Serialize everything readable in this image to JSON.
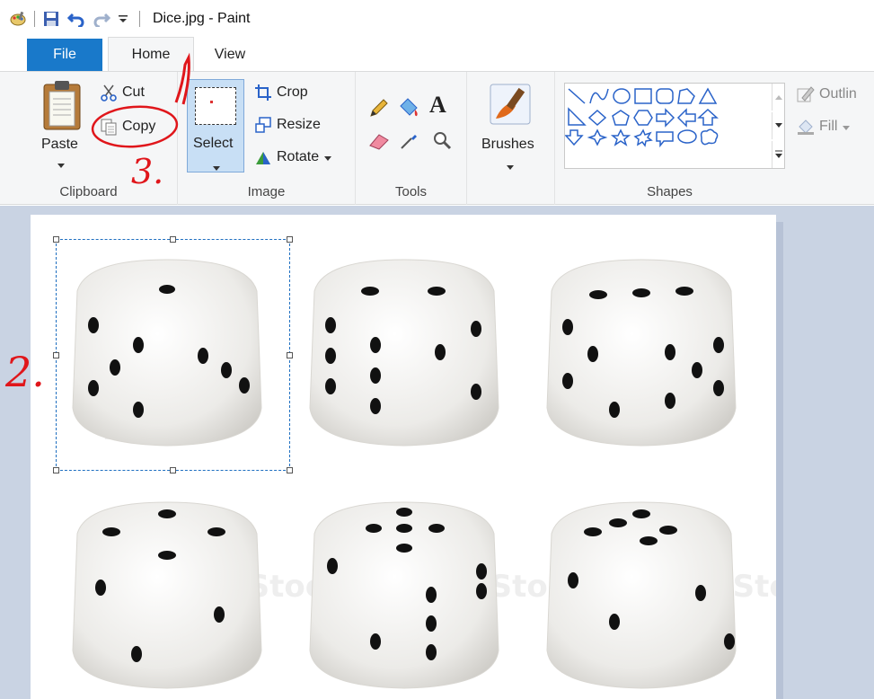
{
  "window": {
    "title": "Dice.jpg - Paint"
  },
  "quick_access": {
    "items": [
      "paint-app-icon",
      "save-icon",
      "undo-icon",
      "redo-icon",
      "customize-icon"
    ]
  },
  "tabs": [
    {
      "label": "File",
      "active": false
    },
    {
      "label": "Home",
      "active": true
    },
    {
      "label": "View",
      "active": false
    }
  ],
  "ribbon": {
    "clipboard": {
      "label": "Clipboard",
      "paste": "Paste",
      "cut": "Cut",
      "copy": "Copy"
    },
    "image": {
      "label": "Image",
      "select": "Select",
      "crop": "Crop",
      "resize": "Resize",
      "rotate": "Rotate"
    },
    "tools": {
      "label": "Tools"
    },
    "brushes": {
      "label": "Brushes"
    },
    "shapes": {
      "label": "Shapes",
      "outline": "Outlin",
      "fill": "Fill"
    }
  },
  "annotations": {
    "one": "1",
    "two": "2.",
    "three": "3."
  },
  "canvas": {
    "image_name": "Dice.jpg",
    "watermark": "iStock"
  },
  "colors": {
    "accent": "#1979ca",
    "ribbon_bg": "#f5f6f7",
    "workspace_bg": "#c9d3e3",
    "annotation_red": "#e0161b",
    "selected_button": "#c8dff5"
  }
}
